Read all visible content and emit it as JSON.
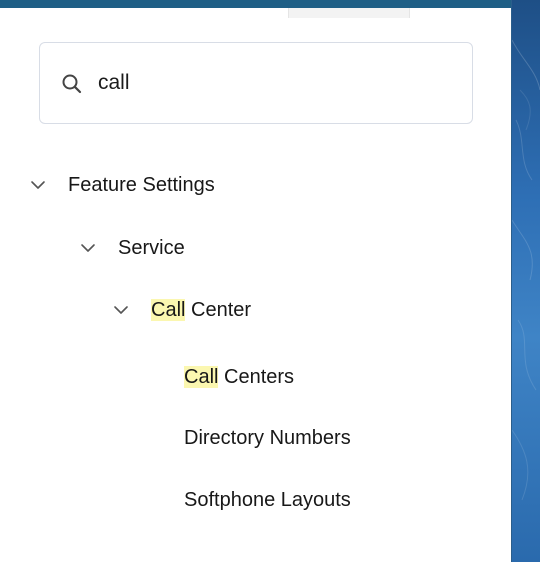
{
  "search": {
    "value": "call",
    "icon": "search-icon"
  },
  "tree": {
    "feature_settings": {
      "label": "Feature Settings",
      "expanded": true
    },
    "service": {
      "label": "Service",
      "expanded": true
    },
    "call_center": {
      "highlight": "Call",
      "rest": " Center",
      "expanded": true
    },
    "call_centers": {
      "highlight": "Call",
      "rest": " Centers"
    },
    "directory_numbers": {
      "label": "Directory Numbers"
    },
    "softphone_layouts": {
      "label": "Softphone Layouts"
    }
  },
  "colors": {
    "highlight": "#fbf7b0",
    "header_bar": "#1f5f86",
    "side_panel": "#2e6fb5"
  }
}
